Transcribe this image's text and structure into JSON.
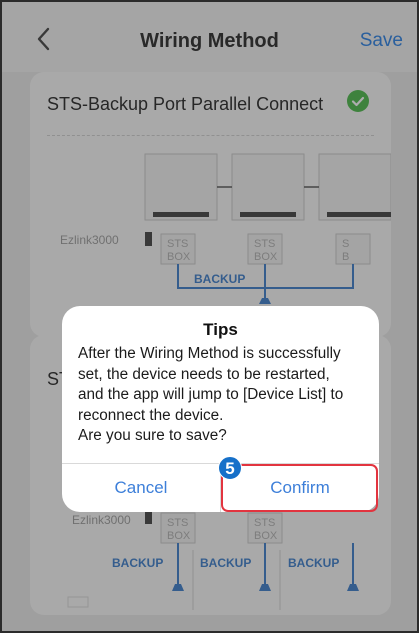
{
  "header": {
    "title": "Wiring Method",
    "save_label": "Save",
    "back_icon": "chevron-left-icon"
  },
  "options": [
    {
      "label": "STS-Backup Port Parallel Connect",
      "selected": true,
      "diagram": {
        "device_label": "Ezlink3000",
        "box_labels": [
          "STS",
          "BOX",
          "STS",
          "BOX",
          "S",
          "B"
        ],
        "bus_label": "BACKUP"
      }
    },
    {
      "label": "ST",
      "selected": false,
      "diagram": {
        "device_label": "Ezlink3000",
        "box_labels": [
          "STS",
          "BOX",
          "STS",
          "BOX"
        ],
        "backup_labels": [
          "BACKUP",
          "BACKUP",
          "BACKUP"
        ]
      }
    }
  ],
  "dialog": {
    "title": "Tips",
    "body_lines": [
      "After the Wiring Method is successfully",
      "set, the device needs to be restarted,",
      "and the app will jump to [Device List] to",
      "reconnect the device.",
      "Are you sure to save?"
    ],
    "cancel_label": "Cancel",
    "confirm_label": "Confirm"
  },
  "callout": {
    "step_number": "5",
    "highlight_color": "#e2343f",
    "badge_color": "#1670c9"
  },
  "colors": {
    "accent": "#3d7fd9",
    "check_green": "#5cc05b",
    "wire_blue": "#4f8ad0"
  }
}
